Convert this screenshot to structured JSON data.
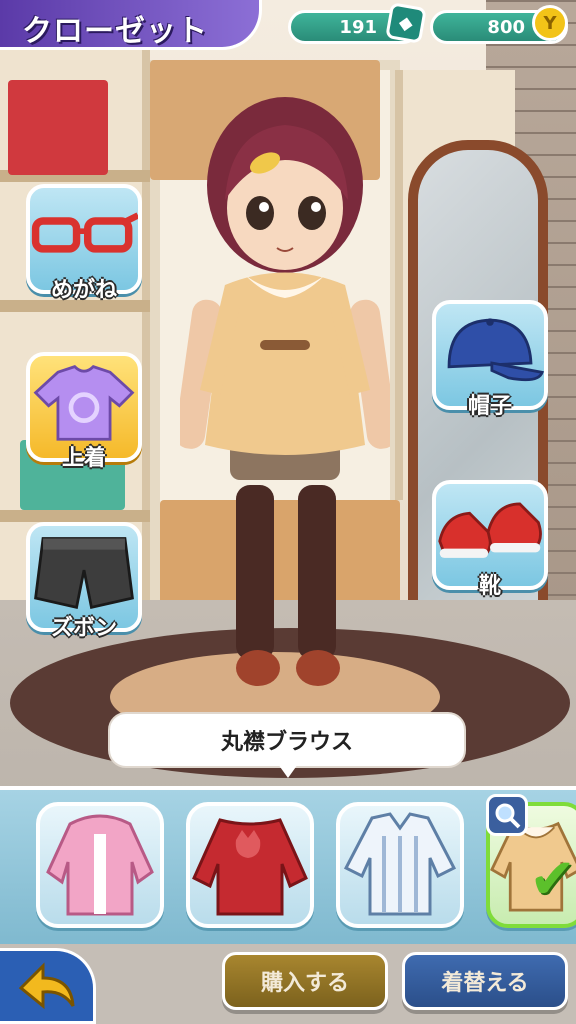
{
  "header": {
    "title": "クローゼット",
    "gems": "191",
    "coins": "800",
    "gem_icon": "gem-icon",
    "coin_icon": "coin-icon",
    "coin_glyph": "Y"
  },
  "categories": [
    {
      "label": "めがね",
      "icon": "glasses-icon",
      "active": false
    },
    {
      "label": "上着",
      "icon": "shirt-icon",
      "active": true
    },
    {
      "label": "ズボン",
      "icon": "shorts-icon",
      "active": false
    },
    {
      "label": "帽子",
      "icon": "cap-icon",
      "active": false
    },
    {
      "label": "靴",
      "icon": "sneakers-icon",
      "active": false
    }
  ],
  "selected_item_name": "丸襟ブラウス",
  "items": [
    {
      "icon": "pink-hoodie-icon",
      "selected": false
    },
    {
      "icon": "red-cat-sweater-icon",
      "selected": false
    },
    {
      "icon": "striped-shirt-icon",
      "selected": false
    },
    {
      "icon": "round-collar-blouse-icon",
      "selected": true
    }
  ],
  "actions": {
    "buy": "購入する",
    "change": "着替える",
    "back_icon": "back-arrow-icon"
  },
  "colors": {
    "accent_purple": "#5b3aa8",
    "currency_teal": "#2a8c78",
    "selected_green": "#5cc02b"
  }
}
